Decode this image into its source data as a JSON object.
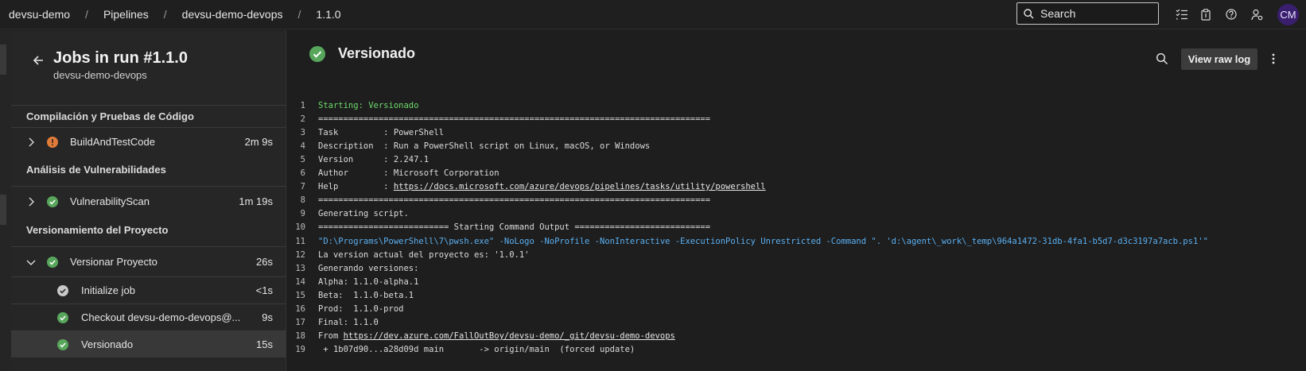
{
  "breadcrumb": {
    "org": "devsu-demo",
    "section": "Pipelines",
    "pipeline": "devsu-demo-devops",
    "run": "1.1.0",
    "separator": "/"
  },
  "search": {
    "placeholder": "Search"
  },
  "user": {
    "initials": "CM"
  },
  "jobs_panel": {
    "title": "Jobs in run #1.1.0",
    "subtitle": "devsu-demo-devops",
    "stages": [
      {
        "label": "Compilación y Pruebas de Código",
        "jobs": [
          {
            "name": "BuildAndTestCode",
            "duration": "2m 9s",
            "status": "warning",
            "expanded": false
          }
        ]
      },
      {
        "label": "Análisis de Vulnerabilidades",
        "jobs": [
          {
            "name": "VulnerabilityScan",
            "duration": "1m 19s",
            "status": "success",
            "expanded": false
          }
        ]
      },
      {
        "label": "Versionamiento del Proyecto",
        "jobs": [
          {
            "name": "Versionar Proyecto",
            "duration": "26s",
            "status": "success",
            "expanded": true
          }
        ]
      }
    ],
    "steps": [
      {
        "name": "Initialize job",
        "duration": "<1s",
        "status": "done"
      },
      {
        "name": "Checkout devsu-demo-devops@...",
        "duration": "9s",
        "status": "success"
      },
      {
        "name": "Versionado",
        "duration": "15s",
        "status": "success",
        "selected": true
      }
    ]
  },
  "log_view": {
    "step_title": "Versionado",
    "view_raw_label": "View raw log",
    "lines": [
      {
        "n": "1",
        "text": "Starting: Versionado",
        "style": "green"
      },
      {
        "n": "2",
        "text": "==============================================================================",
        "style": "plain"
      },
      {
        "n": "3",
        "text": "Task         : PowerShell",
        "style": "plain"
      },
      {
        "n": "4",
        "text": "Description  : Run a PowerShell script on Linux, macOS, or Windows",
        "style": "plain"
      },
      {
        "n": "5",
        "text": "Version      : 2.247.1",
        "style": "plain"
      },
      {
        "n": "6",
        "text": "Author       : Microsoft Corporation",
        "style": "plain"
      },
      {
        "n": "7",
        "text": "Help         : ",
        "link": "https://docs.microsoft.com/azure/devops/pipelines/tasks/utility/powershell",
        "style": "plain"
      },
      {
        "n": "8",
        "text": "==============================================================================",
        "style": "plain"
      },
      {
        "n": "9",
        "text": "Generating script.",
        "style": "plain"
      },
      {
        "n": "10",
        "text": "========================== Starting Command Output ===========================",
        "style": "plain"
      },
      {
        "n": "11",
        "text": "\"D:\\Programs\\PowerShell\\7\\pwsh.exe\" -NoLogo -NoProfile -NonInteractive -ExecutionPolicy Unrestricted -Command \". 'd:\\agent\\_work\\_temp\\964a1472-31db-4fa1-b5d7-d3c3197a7acb.ps1'\"",
        "style": "blue"
      },
      {
        "n": "12",
        "text": "La version actual del proyecto es: '1.0.1'",
        "style": "plain"
      },
      {
        "n": "13",
        "text": "Generando versiones:",
        "style": "plain"
      },
      {
        "n": "14",
        "text": "Alpha: 1.1.0-alpha.1",
        "style": "plain"
      },
      {
        "n": "15",
        "text": "Beta:  1.1.0-beta.1",
        "style": "plain"
      },
      {
        "n": "16",
        "text": "Prod:  1.1.0-prod",
        "style": "plain"
      },
      {
        "n": "17",
        "text": "Final: 1.1.0",
        "style": "plain"
      },
      {
        "n": "18",
        "text": "From ",
        "link": "https://dev.azure.com/FallOutBoy/devsu-demo/_git/devsu-demo-devops",
        "style": "plain"
      },
      {
        "n": "19",
        "text": " + 1b07d90...a28d09d main       -> origin/main  (forced update)",
        "style": "plain"
      }
    ]
  },
  "colors": {
    "success": "#58a65c",
    "warning": "#e07b39",
    "done": "#c8c8c8",
    "accent": "#4aa0e6"
  },
  "icons": {
    "top": [
      "checklist-icon",
      "clipboard-icon",
      "help-icon",
      "user-settings-icon"
    ]
  }
}
